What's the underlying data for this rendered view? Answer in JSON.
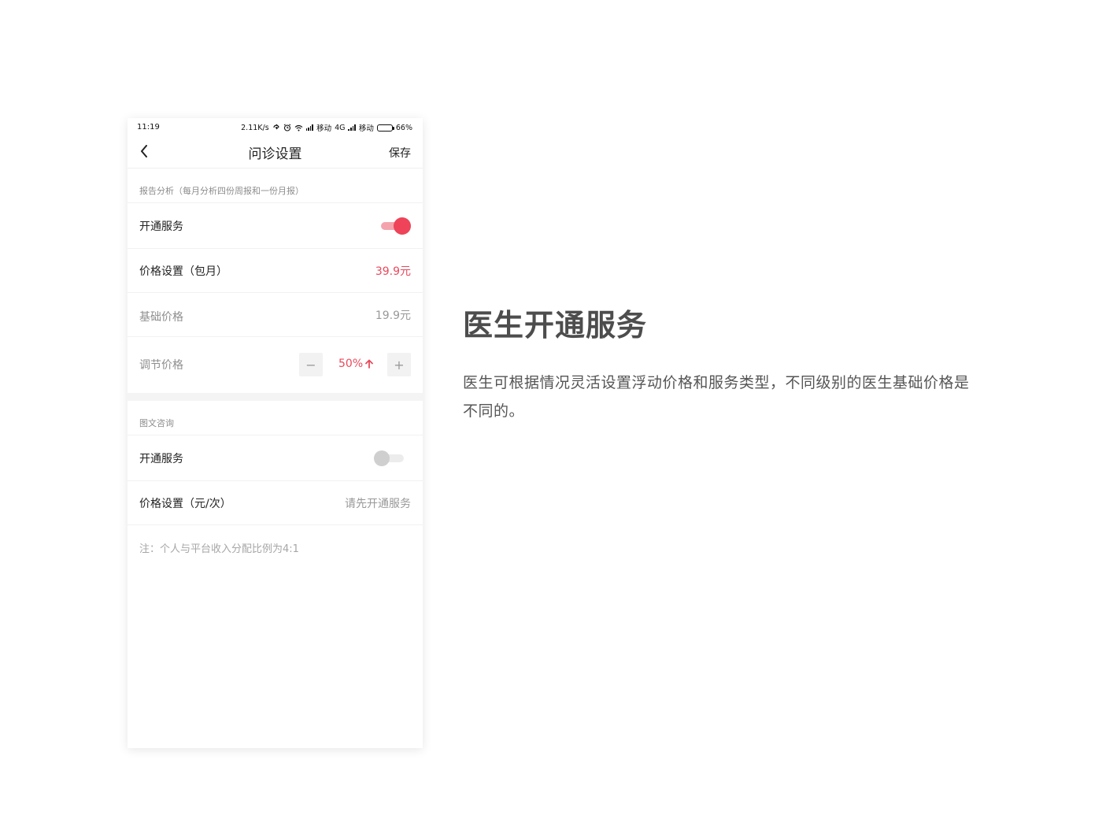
{
  "status_bar": {
    "time": "11:19",
    "net_speed": "2.11K/s",
    "carrier1": "移动",
    "network_type": "4G",
    "carrier2": "移动",
    "battery": "66%",
    "battery_level": 0.66
  },
  "nav": {
    "title": "问诊设置",
    "save_label": "保存"
  },
  "report_section": {
    "label": "报告分析（每月分析四份周报和一份月报）",
    "enable_label": "开通服务",
    "enabled": true,
    "price_label": "价格设置（包月）",
    "price_value": "39.9元",
    "base_label": "基础价格",
    "base_value": "19.9元",
    "adjust_label": "调节价格",
    "adjust_value": "50%",
    "minus": "−",
    "plus": "+"
  },
  "consult_section": {
    "label": "图文咨询",
    "enable_label": "开通服务",
    "enabled": false,
    "price_label": "价格设置（元/次）",
    "price_value": "请先开通服务"
  },
  "note": "注：个人与平台收入分配比例为4:1",
  "hero": {
    "title": "医生开通服务",
    "description": "医生可根据情况灵活设置浮动价格和服务类型，不同级别的医生基础价格是不同的。"
  },
  "colors": {
    "accent": "#ee4358",
    "muted_text": "#999999"
  }
}
